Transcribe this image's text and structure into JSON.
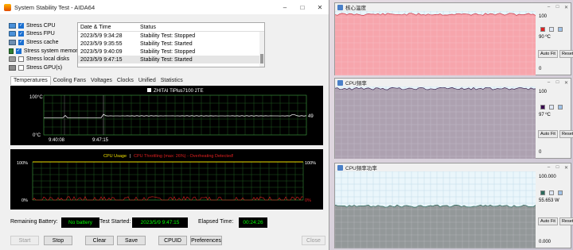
{
  "main_window": {
    "title": "System Stability Test - AIDA64",
    "checks": [
      {
        "label": "Stress CPU",
        "checked": true,
        "icon": "cpu-icon"
      },
      {
        "label": "Stress FPU",
        "checked": true,
        "icon": "fpu-icon"
      },
      {
        "label": "Stress cache",
        "checked": true,
        "icon": "cache-icon"
      },
      {
        "label": "Stress system memory",
        "checked": true,
        "icon": "memory-icon"
      },
      {
        "label": "Stress local disks",
        "checked": false,
        "icon": "disk-icon"
      },
      {
        "label": "Stress GPU(s)",
        "checked": false,
        "icon": "gpu-icon"
      }
    ],
    "status_table": {
      "headers": [
        "Date & Time",
        "Status"
      ],
      "rows": [
        [
          "2023/5/9 9:34:28",
          "Stability Test: Stopped"
        ],
        [
          "2023/5/9 9:35:55",
          "Stability Test: Started"
        ],
        [
          "2023/5/9 9:40:09",
          "Stability Test: Stopped"
        ],
        [
          "2023/5/9 9:47:15",
          "Stability Test: Started"
        ]
      ]
    },
    "tabs": [
      "Temperatures",
      "Cooling Fans",
      "Voltages",
      "Clocks",
      "Unified",
      "Statistics"
    ],
    "active_tab": "Temperatures",
    "temp_chart": {
      "legend": "ZHITAI TiPlus7100 2TE",
      "ymax_label": "100°C",
      "ymin_label": "0°C",
      "x_labels": [
        "9:40:08",
        "9:47:15"
      ],
      "value_label": "49"
    },
    "cpu_chart": {
      "legend_usage": "CPU Usage",
      "legend_sep": "|",
      "legend_throttle": "CPU Throttling (max: 26%) - Overheating Detected!",
      "y_top_left": "100%",
      "y_bottom_left": "0%",
      "y_top_right": "100%",
      "y_bottom_right": "0%"
    },
    "status_fields": {
      "battery_label": "Remaining Battery:",
      "battery_value": "No battery",
      "started_label": "Test Started:",
      "started_value": "2023/5/9 9:47:15",
      "elapsed_label": "Elapsed Time:",
      "elapsed_value": "00:24:26"
    },
    "buttons": {
      "start": "Start",
      "stop": "Stop",
      "clear": "Clear",
      "save": "Save",
      "cpuid": "CPUID",
      "preferences": "Preferences",
      "close": "Close"
    }
  },
  "monitors": [
    {
      "title": "核心溫度",
      "top": "100",
      "bottom": "0",
      "value": "90 ºC",
      "fill_color": "#f8a0a8",
      "line_color": "#cc3344",
      "swatch": "#e02020",
      "level": 0.95,
      "auto_fit": "Auto Fit",
      "reset": "Reset"
    },
    {
      "title": "CPU頻率",
      "top": "100",
      "bottom": "0",
      "value": "97 ºC",
      "fill_color": "#aa9cac",
      "line_color": "#3a2050",
      "swatch": "#3a0a50",
      "level": 0.97,
      "auto_fit": "Auto Fit",
      "reset": "Reset"
    },
    {
      "title": "CPU頻率功率",
      "top": "100.000",
      "bottom": "0.000",
      "value": "55.653 W",
      "fill_color": "#8e9294",
      "line_color": "#2c6a5c",
      "swatch": "#2c6a5c",
      "level": 0.55,
      "auto_fit": "Auto Fit",
      "reset": "Reset"
    }
  ]
}
